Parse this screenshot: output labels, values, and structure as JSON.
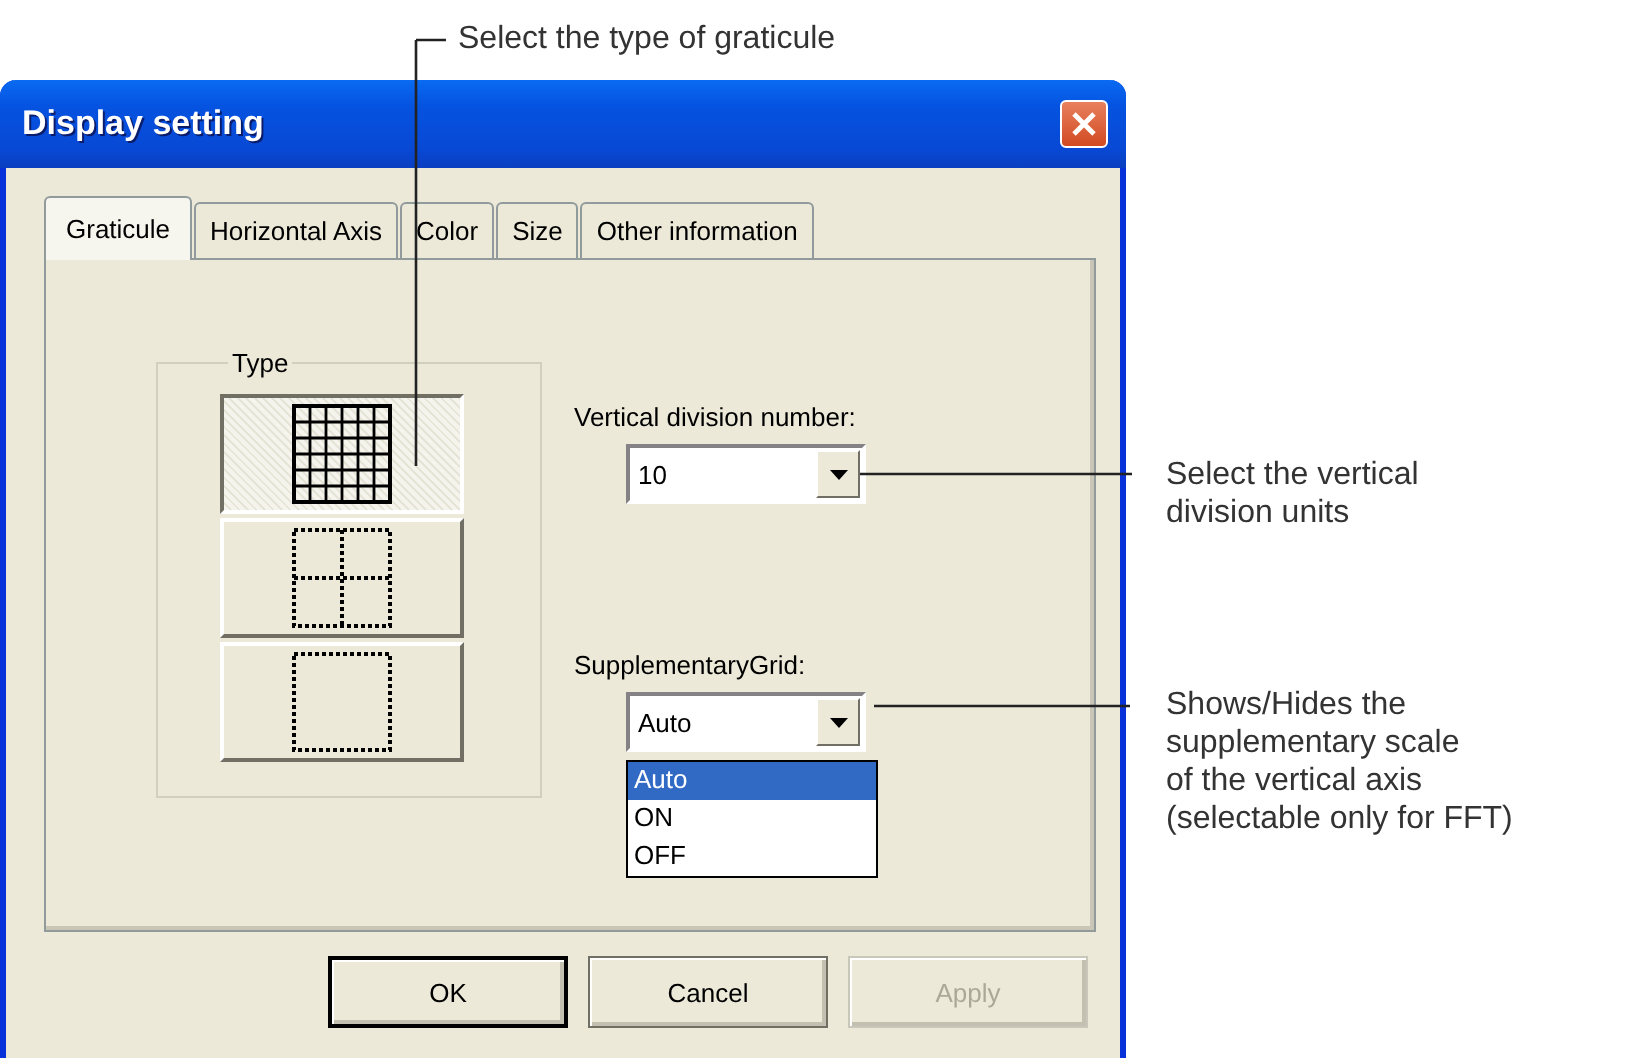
{
  "window": {
    "title": "Display setting"
  },
  "tabs": [
    {
      "label": "Graticule",
      "selected": true
    },
    {
      "label": "Horizontal Axis",
      "selected": false
    },
    {
      "label": "Color",
      "selected": false
    },
    {
      "label": "Size",
      "selected": false
    },
    {
      "label": "Other information",
      "selected": false
    }
  ],
  "type_group": {
    "label": "Type",
    "options": [
      {
        "kind": "full-grid",
        "selected": true
      },
      {
        "kind": "quad-grid",
        "selected": false
      },
      {
        "kind": "frame-only",
        "selected": false
      }
    ]
  },
  "vertical_division": {
    "label": "Vertical division number:",
    "value": "10"
  },
  "supplementary_grid": {
    "label": "SupplementaryGrid:",
    "value": "Auto",
    "expanded": true,
    "options": [
      {
        "label": "Auto",
        "selected": true
      },
      {
        "label": "ON",
        "selected": false
      },
      {
        "label": "OFF",
        "selected": false
      }
    ]
  },
  "buttons": [
    {
      "label": "OK",
      "default": true,
      "disabled": false
    },
    {
      "label": "Cancel",
      "default": false,
      "disabled": false
    },
    {
      "label": "Apply",
      "default": false,
      "disabled": true
    }
  ],
  "callouts": [
    {
      "lines": [
        "Select the type of graticule"
      ]
    },
    {
      "lines": [
        "Select the vertical",
        "division units"
      ]
    },
    {
      "lines": [
        "Shows/Hides the",
        "supplementary scale",
        "of the vertical axis",
        "(selectable only for FFT)"
      ]
    }
  ]
}
